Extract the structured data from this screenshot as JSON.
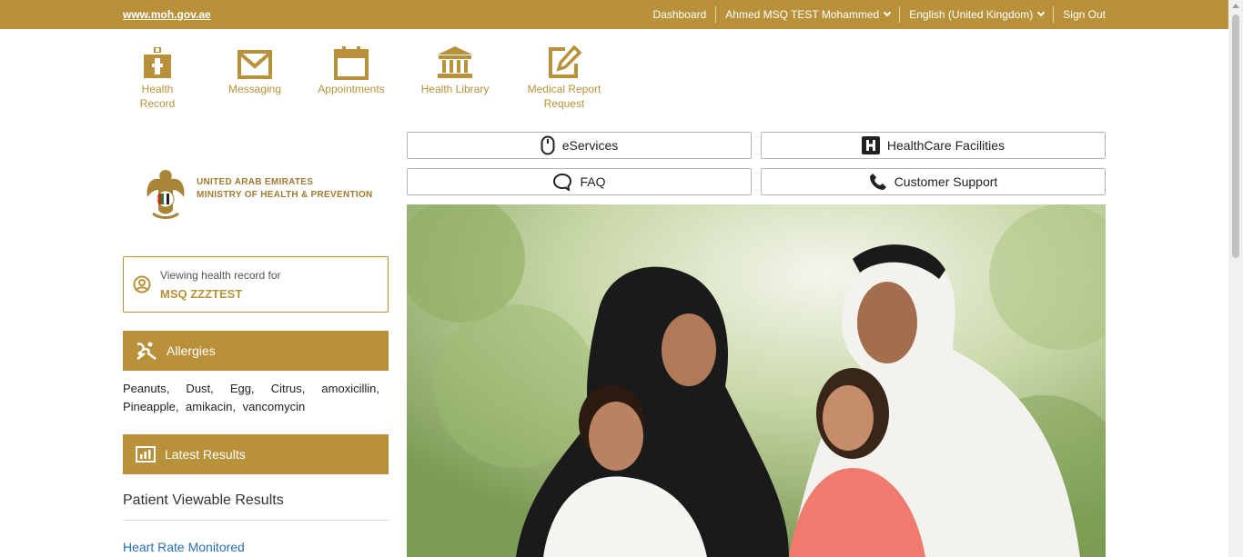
{
  "topbar": {
    "site_link": "www.moh.gov.ae",
    "dashboard": "Dashboard",
    "user": "Ahmed MSQ TEST Mohammed",
    "language": "English (United Kingdom)",
    "sign_out": "Sign Out",
    "color": "#b8913a"
  },
  "quicknav": [
    {
      "label": "Health Record",
      "icon": "health-record-icon"
    },
    {
      "label": "Messaging",
      "icon": "envelope-icon"
    },
    {
      "label": "Appointments",
      "icon": "calendar-icon"
    },
    {
      "label": "Health Library",
      "icon": "library-icon"
    },
    {
      "label_line1": "Medical Report",
      "label_line2": "Request",
      "icon": "edit-icon"
    }
  ],
  "logo": {
    "line1": "UNITED ARAB EMIRATES",
    "line2": "MINISTRY OF HEALTH & PREVENTION"
  },
  "viewing": {
    "label": "Viewing health record for",
    "name": "MSQ ZZZTEST"
  },
  "allergies": {
    "title": "Allergies",
    "items": "Peanuts, Dust, Egg, Citrus, amoxicillin, Pineapple, amikacin, vancomycin"
  },
  "latest_results": {
    "title": "Latest Results",
    "subtitle": "Patient Viewable Results",
    "link": "Heart Rate Monitored"
  },
  "services": {
    "eservices": "eServices",
    "facilities": "HealthCare Facilities",
    "faq": "FAQ",
    "support": "Customer Support"
  }
}
